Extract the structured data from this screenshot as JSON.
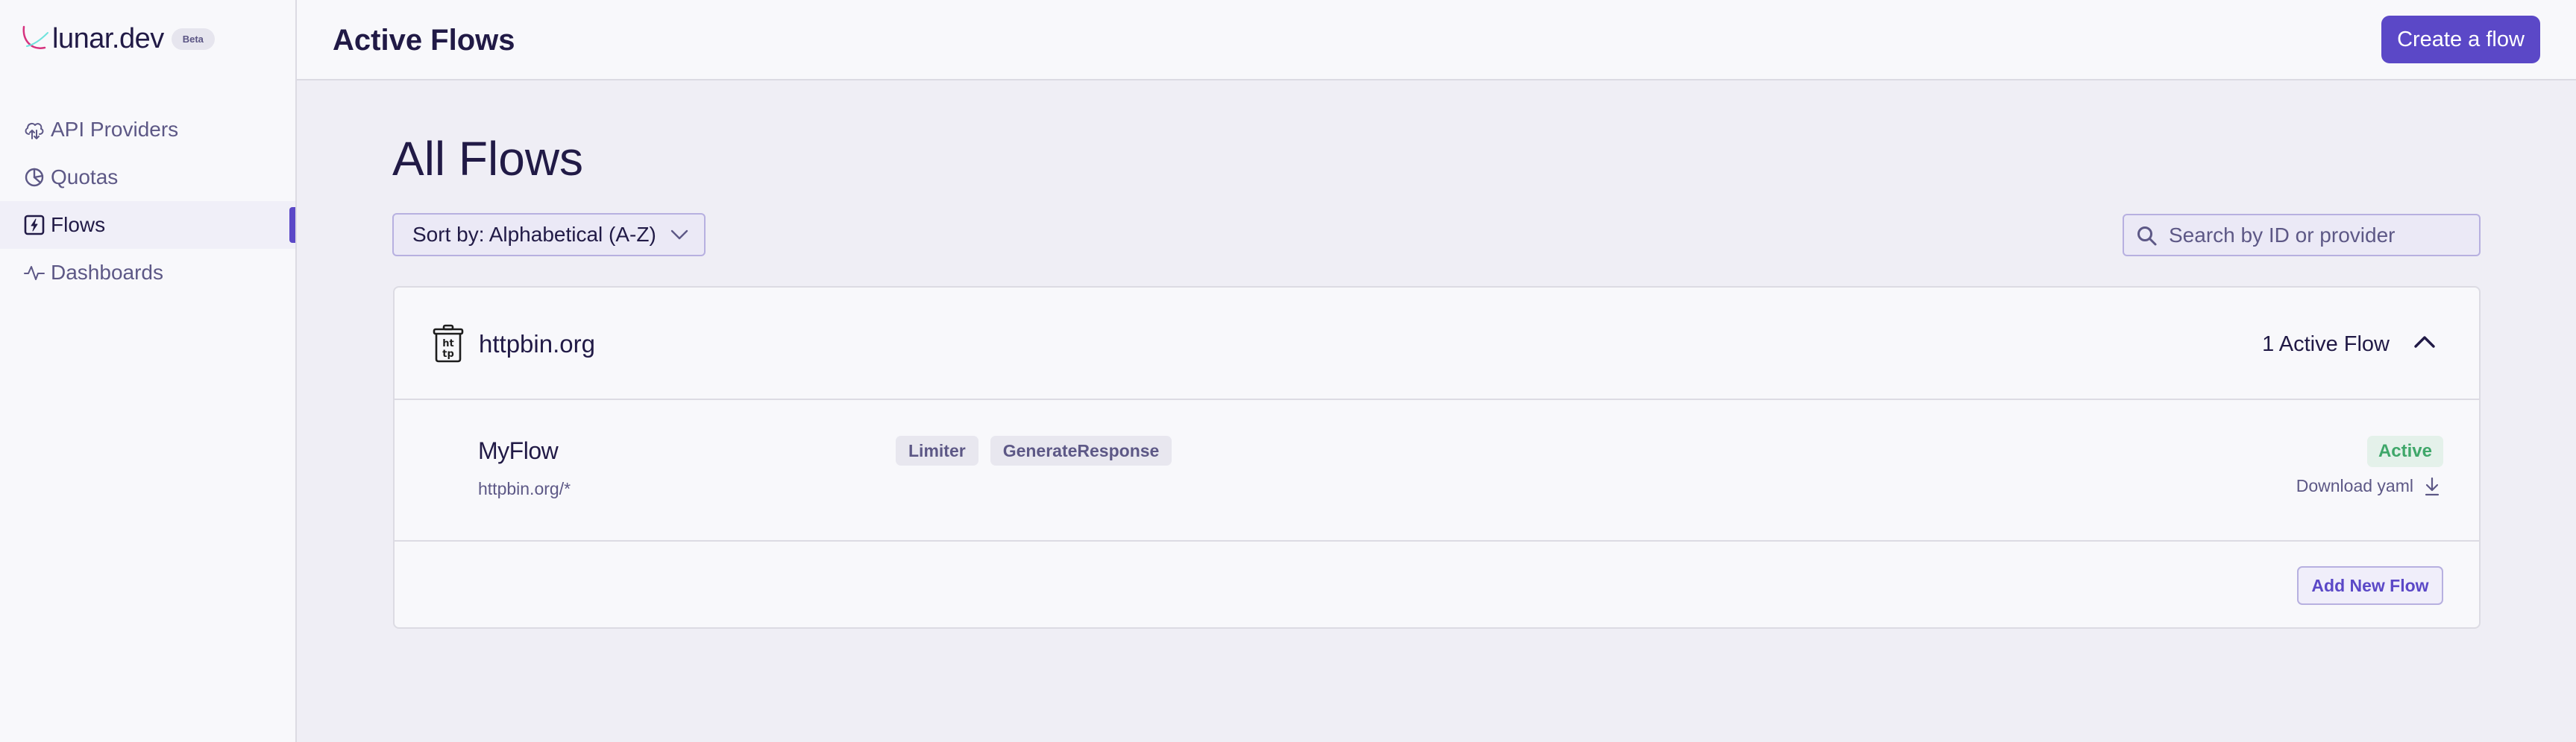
{
  "brand": {
    "name": "lunar.dev",
    "badge": "Beta",
    "colors": {
      "accent": "#5b48c7",
      "logo_pink": "#d6337f",
      "logo_cyan": "#6fe3dd"
    }
  },
  "sidebar": {
    "items": [
      {
        "label": "API Providers",
        "icon": "cloud-upload-download-icon",
        "active": false
      },
      {
        "label": "Quotas",
        "icon": "pie-chart-icon",
        "active": false
      },
      {
        "label": "Flows",
        "icon": "lightning-box-icon",
        "active": true
      },
      {
        "label": "Dashboards",
        "icon": "pulse-icon",
        "active": false
      }
    ]
  },
  "header": {
    "title": "Active Flows",
    "create_button": "Create a flow"
  },
  "main": {
    "title": "All Flows",
    "sort": {
      "value": "Sort by: Alphabetical (A-Z)"
    },
    "search": {
      "placeholder": "Search by ID or provider",
      "value": ""
    },
    "providers": [
      {
        "name": "httpbin.org",
        "icon": "http-jar-icon",
        "active_count_label": "1 Active Flow",
        "expanded": true,
        "flows": [
          {
            "name": "MyFlow",
            "url": "httpbin.org/*",
            "tags": [
              "Limiter",
              "GenerateResponse"
            ],
            "status": "Active",
            "download_label": "Download yaml"
          }
        ],
        "add_button": "Add New Flow"
      }
    ]
  }
}
